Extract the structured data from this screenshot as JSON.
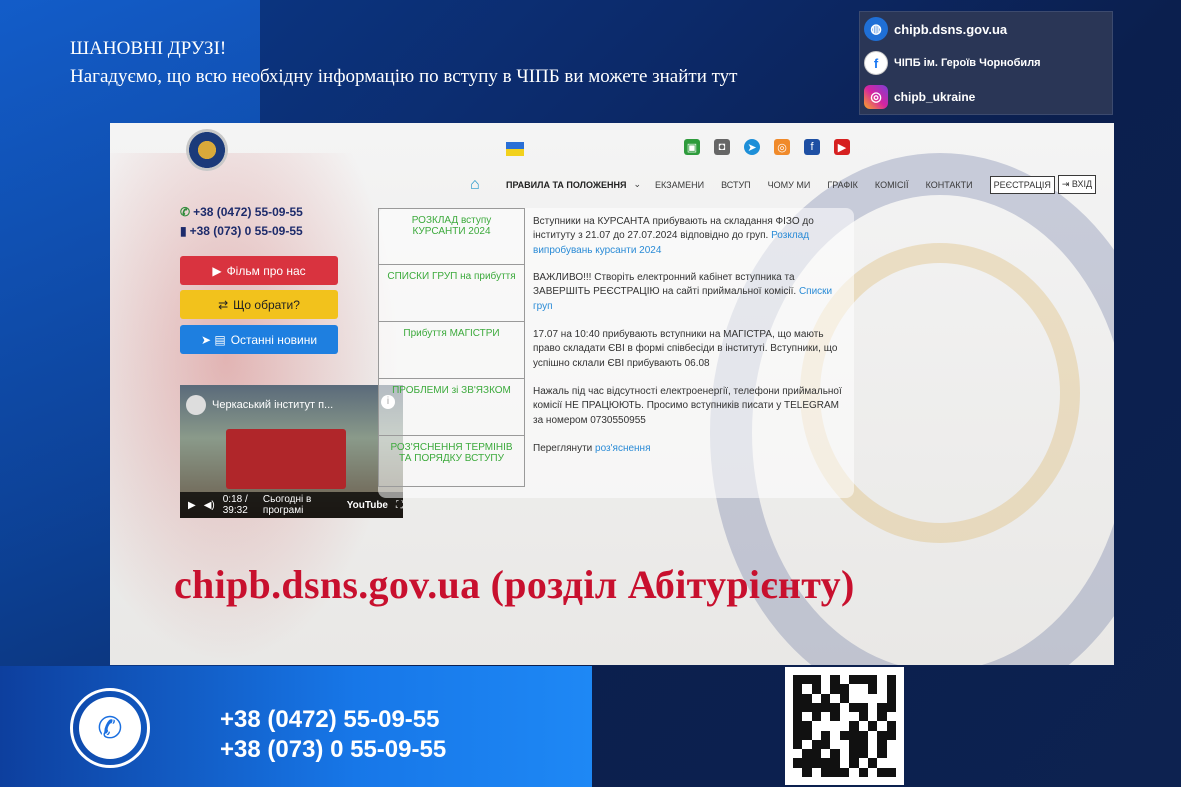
{
  "announcement": {
    "heading": "ШАНОВНІ ДРУЗІ!",
    "text": "Нагадуємо, що всю необхідну інформацію по вступу в ЧІПБ ви можете знайти тут"
  },
  "social": [
    {
      "icon": "globe-icon",
      "label": "chipb.dsns.gov.ua",
      "color": "#1f6fd6"
    },
    {
      "icon": "facebook-icon",
      "label": "ЧІПБ ім. Героїв Чорнобиля",
      "color": "#1877f2"
    },
    {
      "icon": "instagram-icon",
      "label": "chipb_ukraine",
      "color": "#d6249f"
    }
  ],
  "site": {
    "nav": {
      "rules": "ПРАВИЛА ТА ПОЛОЖЕННЯ",
      "exams": "ЕКЗАМЕНИ",
      "admission": "ВСТУП",
      "why": "ЧОМУ МИ",
      "schedule": "ГРАФІК",
      "commissions": "КОМІСІЇ",
      "contacts": "КОНТАКТИ",
      "register": "РЕЄСТРАЦІЯ",
      "login": "ВХІД"
    },
    "phones": [
      "+38 (0472) 55-09-55",
      "+38 (073) 0 55-09-55"
    ],
    "buttons": {
      "film": "Фільм про нас",
      "choose": "Що обрати?",
      "news": "Останні новини"
    },
    "video": {
      "title": "Черкаський інститут п...",
      "time": "0:18 / 39:32",
      "caption": "Сьогодні в програмі",
      "platform": "YouTube"
    },
    "table": [
      {
        "key": "РОЗКЛАД вступу КУРСАНТИ 2024",
        "text": "Вступники на КУРСАНТА прибувають на складання ФІЗО до інституту з 21.07 до 27.07.2024 відповідно до груп. ",
        "link": "Розклад випробувань курсанти 2024"
      },
      {
        "key": "СПИСКИ ГРУП на прибуття",
        "text": "ВАЖЛИВО!!! Створіть електронний кабінет вступника та ЗАВЕРШІТЬ РЕЄСТРАЦІЮ на сайті приймальної комісії. ",
        "link": "Списки груп"
      },
      {
        "key": "Прибуття МАГІСТРИ",
        "text": "17.07 на 10:40 прибувають вступники на МАГІСТРА, що мають право складати ЄВІ в формі співбесіди в інституті. Вступники, що успішно склали ЄВІ прибувають 06.08",
        "link": ""
      },
      {
        "key": "ПРОБЛЕМИ зі ЗВ'ЯЗКОМ",
        "text": "Нажаль під час відсутності електроенергії, телефони приймальної комісії НЕ ПРАЦЮЮТЬ. Просимо вступників писати у TELEGRAM за номером 0730550955",
        "link": ""
      },
      {
        "key": "РОЗ'ЯСНЕННЯ ТЕРМІНІВ ТА ПОРЯДКУ ВСТУПУ",
        "text": "Переглянути ",
        "link": "роз'яснення"
      }
    ],
    "banner": "chipb.dsns.gov.ua (розділ Абітурієнту)"
  },
  "bottom_phones": [
    "+38 (0472) 55-09-55",
    "+38 (073) 0 55-09-55"
  ]
}
